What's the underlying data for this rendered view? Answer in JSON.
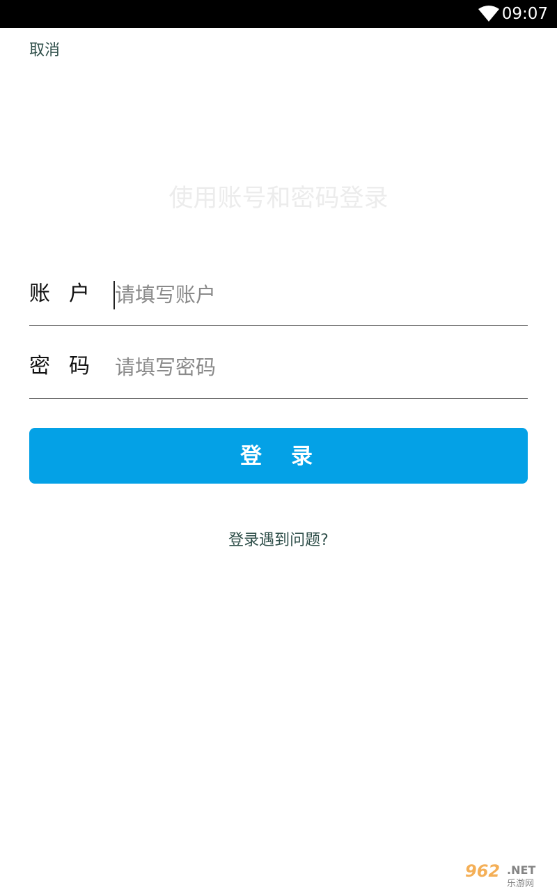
{
  "status_bar": {
    "time": "09:07",
    "icons": [
      "wifi-icon"
    ]
  },
  "header": {
    "cancel_label": "取消"
  },
  "main": {
    "heading": "使用账号和密码登录",
    "account": {
      "label": "账户",
      "value": "",
      "placeholder": "请填写账户"
    },
    "password": {
      "label": "密码",
      "value": "",
      "placeholder": "请填写密码"
    },
    "login_button_label": "登录",
    "help_link_label": "登录遇到问题?"
  },
  "watermark": {
    "text": "962.NET 乐游网"
  },
  "colors": {
    "accent": "#04a1e6",
    "link": "#2f4f4a",
    "status_bar": "#000000",
    "background": "#ffffff"
  }
}
